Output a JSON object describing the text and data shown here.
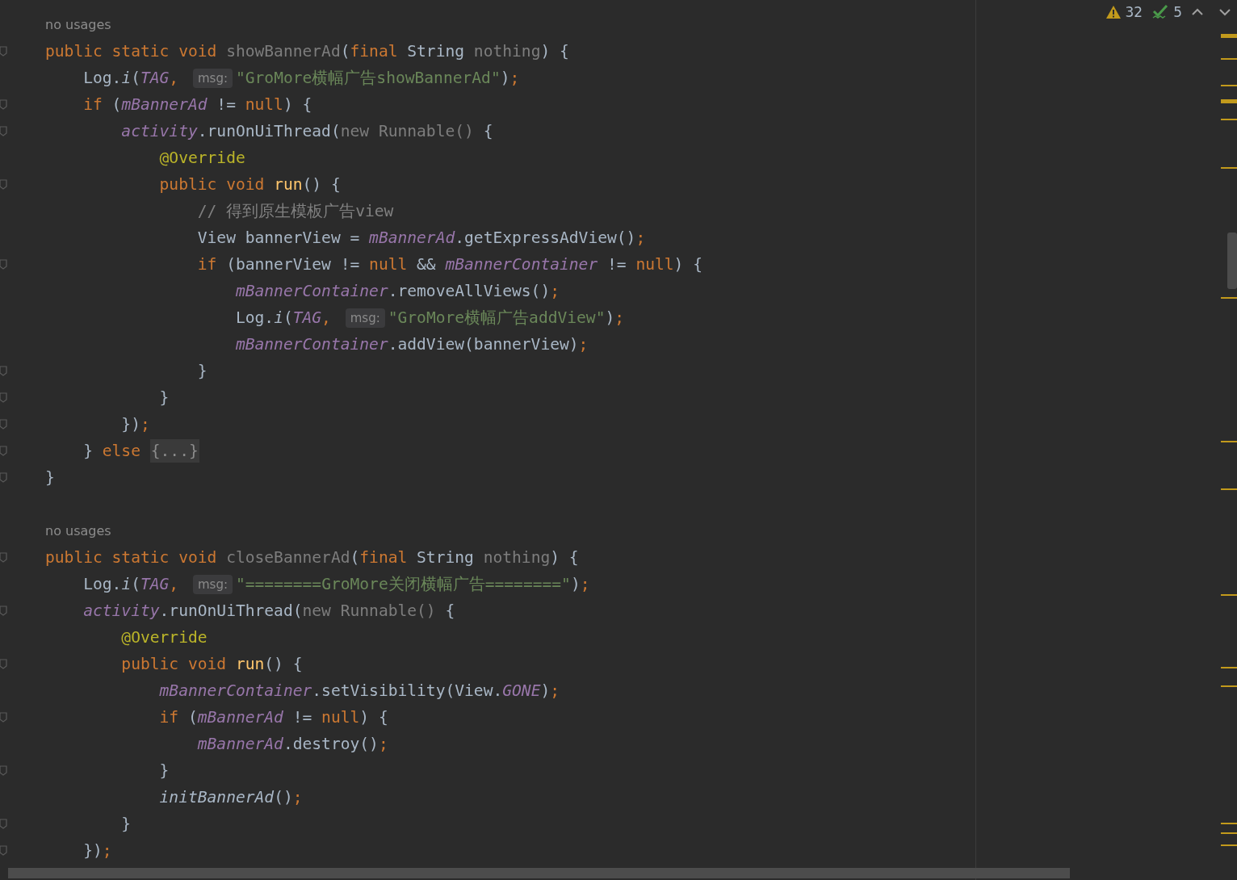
{
  "toolbar": {
    "warnings": "32",
    "passed": "5"
  },
  "lines": [
    {
      "kind": "hint",
      "text": "no usages"
    },
    {
      "kind": "code",
      "fold": true,
      "tokens": [
        {
          "text": "public static void ",
          "kind": "keyword"
        },
        {
          "text": "showBannerAd",
          "kind": "unused"
        },
        {
          "text": "(",
          "kind": "plain"
        },
        {
          "text": "final ",
          "kind": "keyword"
        },
        {
          "text": "String ",
          "kind": "plain"
        },
        {
          "text": "nothing",
          "kind": "unused"
        },
        {
          "text": ") {",
          "kind": "plain"
        }
      ]
    },
    {
      "kind": "code",
      "fold": false,
      "tokens": [
        {
          "text": "    Log.",
          "kind": "plain"
        },
        {
          "text": "i",
          "kind": "static"
        },
        {
          "text": "(",
          "kind": "plain"
        },
        {
          "text": "TAG",
          "kind": "constant"
        },
        {
          "text": ", ",
          "kind": "keyword"
        },
        {
          "text": "msg:",
          "kind": "hint"
        },
        {
          "text": "\"GroMore横幅广告showBannerAd\"",
          "kind": "string"
        },
        {
          "text": ")",
          "kind": "plain"
        },
        {
          "text": ";",
          "kind": "keyword"
        }
      ]
    },
    {
      "kind": "code",
      "fold": true,
      "tokens": [
        {
          "text": "    if ",
          "kind": "keyword"
        },
        {
          "text": "(",
          "kind": "plain"
        },
        {
          "text": "mBannerAd",
          "kind": "field"
        },
        {
          "text": " != ",
          "kind": "plain"
        },
        {
          "text": "null",
          "kind": "keyword"
        },
        {
          "text": ") {",
          "kind": "plain"
        }
      ]
    },
    {
      "kind": "code",
      "fold": true,
      "tokens": [
        {
          "text": "        activity",
          "kind": "field"
        },
        {
          "text": ".runOnUiThread(",
          "kind": "plain"
        },
        {
          "text": "new Runnable()",
          "kind": "unused"
        },
        {
          "text": " {",
          "kind": "plain"
        }
      ]
    },
    {
      "kind": "code",
      "fold": false,
      "tokens": [
        {
          "text": "            @Override",
          "kind": "annotation"
        }
      ]
    },
    {
      "kind": "code",
      "fold": true,
      "tokens": [
        {
          "text": "            public void ",
          "kind": "keyword"
        },
        {
          "text": "run",
          "kind": "declaration"
        },
        {
          "text": "() {",
          "kind": "plain"
        }
      ]
    },
    {
      "kind": "code",
      "fold": false,
      "tokens": [
        {
          "text": "                // 得到原生模板广告view",
          "kind": "comment"
        }
      ]
    },
    {
      "kind": "code",
      "fold": false,
      "tokens": [
        {
          "text": "                View bannerView = ",
          "kind": "plain"
        },
        {
          "text": "mBannerAd",
          "kind": "field"
        },
        {
          "text": ".getExpressAdView()",
          "kind": "plain"
        },
        {
          "text": ";",
          "kind": "keyword"
        }
      ]
    },
    {
      "kind": "code",
      "fold": true,
      "tokens": [
        {
          "text": "                if ",
          "kind": "keyword"
        },
        {
          "text": "(bannerView != ",
          "kind": "plain"
        },
        {
          "text": "null",
          "kind": "keyword"
        },
        {
          "text": " && ",
          "kind": "plain"
        },
        {
          "text": "mBannerContainer",
          "kind": "field"
        },
        {
          "text": " != ",
          "kind": "plain"
        },
        {
          "text": "null",
          "kind": "keyword"
        },
        {
          "text": ") {",
          "kind": "plain"
        }
      ]
    },
    {
      "kind": "code",
      "fold": false,
      "tokens": [
        {
          "text": "                    mBannerContainer",
          "kind": "field"
        },
        {
          "text": ".removeAllViews()",
          "kind": "plain"
        },
        {
          "text": ";",
          "kind": "keyword"
        }
      ]
    },
    {
      "kind": "code",
      "fold": false,
      "tokens": [
        {
          "text": "                    Log.",
          "kind": "plain"
        },
        {
          "text": "i",
          "kind": "static"
        },
        {
          "text": "(",
          "kind": "plain"
        },
        {
          "text": "TAG",
          "kind": "constant"
        },
        {
          "text": ", ",
          "kind": "keyword"
        },
        {
          "text": "msg:",
          "kind": "hint"
        },
        {
          "text": "\"GroMore横幅广告addView\"",
          "kind": "string"
        },
        {
          "text": ")",
          "kind": "plain"
        },
        {
          "text": ";",
          "kind": "keyword"
        }
      ]
    },
    {
      "kind": "code",
      "fold": false,
      "tokens": [
        {
          "text": "                    mBannerContainer",
          "kind": "field"
        },
        {
          "text": ".addView(bannerView)",
          "kind": "plain"
        },
        {
          "text": ";",
          "kind": "keyword"
        }
      ]
    },
    {
      "kind": "code",
      "fold": true,
      "tokens": [
        {
          "text": "                }",
          "kind": "plain"
        }
      ]
    },
    {
      "kind": "code",
      "fold": true,
      "tokens": [
        {
          "text": "            }",
          "kind": "plain"
        }
      ]
    },
    {
      "kind": "code",
      "fold": true,
      "tokens": [
        {
          "text": "        })",
          "kind": "plain"
        },
        {
          "text": ";",
          "kind": "keyword"
        }
      ]
    },
    {
      "kind": "code",
      "fold": true,
      "tokens": [
        {
          "text": "    } ",
          "kind": "plain"
        },
        {
          "text": "else ",
          "kind": "keyword"
        },
        {
          "text": "{...}",
          "kind": "folded"
        }
      ]
    },
    {
      "kind": "code",
      "fold": true,
      "tokens": [
        {
          "text": "}",
          "kind": "plain"
        }
      ]
    },
    {
      "kind": "blank"
    },
    {
      "kind": "hint",
      "text": "no usages"
    },
    {
      "kind": "code",
      "fold": true,
      "tokens": [
        {
          "text": "public static void ",
          "kind": "keyword"
        },
        {
          "text": "closeBannerAd",
          "kind": "unused"
        },
        {
          "text": "(",
          "kind": "plain"
        },
        {
          "text": "final ",
          "kind": "keyword"
        },
        {
          "text": "String ",
          "kind": "plain"
        },
        {
          "text": "nothing",
          "kind": "unused"
        },
        {
          "text": ") {",
          "kind": "plain"
        }
      ]
    },
    {
      "kind": "code",
      "fold": false,
      "tokens": [
        {
          "text": "    Log.",
          "kind": "plain"
        },
        {
          "text": "i",
          "kind": "static"
        },
        {
          "text": "(",
          "kind": "plain"
        },
        {
          "text": "TAG",
          "kind": "constant"
        },
        {
          "text": ", ",
          "kind": "keyword"
        },
        {
          "text": "msg:",
          "kind": "hint"
        },
        {
          "text": "\"========GroMore关闭横幅广告========\"",
          "kind": "string"
        },
        {
          "text": ")",
          "kind": "plain"
        },
        {
          "text": ";",
          "kind": "keyword"
        }
      ]
    },
    {
      "kind": "code",
      "fold": true,
      "tokens": [
        {
          "text": "    activity",
          "kind": "field"
        },
        {
          "text": ".runOnUiThread(",
          "kind": "plain"
        },
        {
          "text": "new Runnable()",
          "kind": "unused"
        },
        {
          "text": " {",
          "kind": "plain"
        }
      ]
    },
    {
      "kind": "code",
      "fold": false,
      "tokens": [
        {
          "text": "        @Override",
          "kind": "annotation"
        }
      ]
    },
    {
      "kind": "code",
      "fold": true,
      "tokens": [
        {
          "text": "        public void ",
          "kind": "keyword"
        },
        {
          "text": "run",
          "kind": "declaration"
        },
        {
          "text": "() {",
          "kind": "plain"
        }
      ]
    },
    {
      "kind": "code",
      "fold": false,
      "tokens": [
        {
          "text": "            mBannerContainer",
          "kind": "field"
        },
        {
          "text": ".setVisibility(View.",
          "kind": "plain"
        },
        {
          "text": "GONE",
          "kind": "constant"
        },
        {
          "text": ")",
          "kind": "plain"
        },
        {
          "text": ";",
          "kind": "keyword"
        }
      ]
    },
    {
      "kind": "code",
      "fold": true,
      "tokens": [
        {
          "text": "            if ",
          "kind": "keyword"
        },
        {
          "text": "(",
          "kind": "plain"
        },
        {
          "text": "mBannerAd",
          "kind": "field"
        },
        {
          "text": " != ",
          "kind": "plain"
        },
        {
          "text": "null",
          "kind": "keyword"
        },
        {
          "text": ") {",
          "kind": "plain"
        }
      ]
    },
    {
      "kind": "code",
      "fold": false,
      "tokens": [
        {
          "text": "                mBannerAd",
          "kind": "field"
        },
        {
          "text": ".destroy()",
          "kind": "plain"
        },
        {
          "text": ";",
          "kind": "keyword"
        }
      ]
    },
    {
      "kind": "code",
      "fold": true,
      "tokens": [
        {
          "text": "            }",
          "kind": "plain"
        }
      ]
    },
    {
      "kind": "code",
      "fold": false,
      "tokens": [
        {
          "text": "            initBannerAd",
          "kind": "static"
        },
        {
          "text": "()",
          "kind": "plain"
        },
        {
          "text": ";",
          "kind": "keyword"
        }
      ]
    },
    {
      "kind": "code",
      "fold": true,
      "tokens": [
        {
          "text": "        }",
          "kind": "plain"
        }
      ]
    },
    {
      "kind": "code",
      "fold": true,
      "tokens": [
        {
          "text": "    })",
          "kind": "plain"
        },
        {
          "text": ";",
          "kind": "keyword"
        }
      ]
    }
  ]
}
